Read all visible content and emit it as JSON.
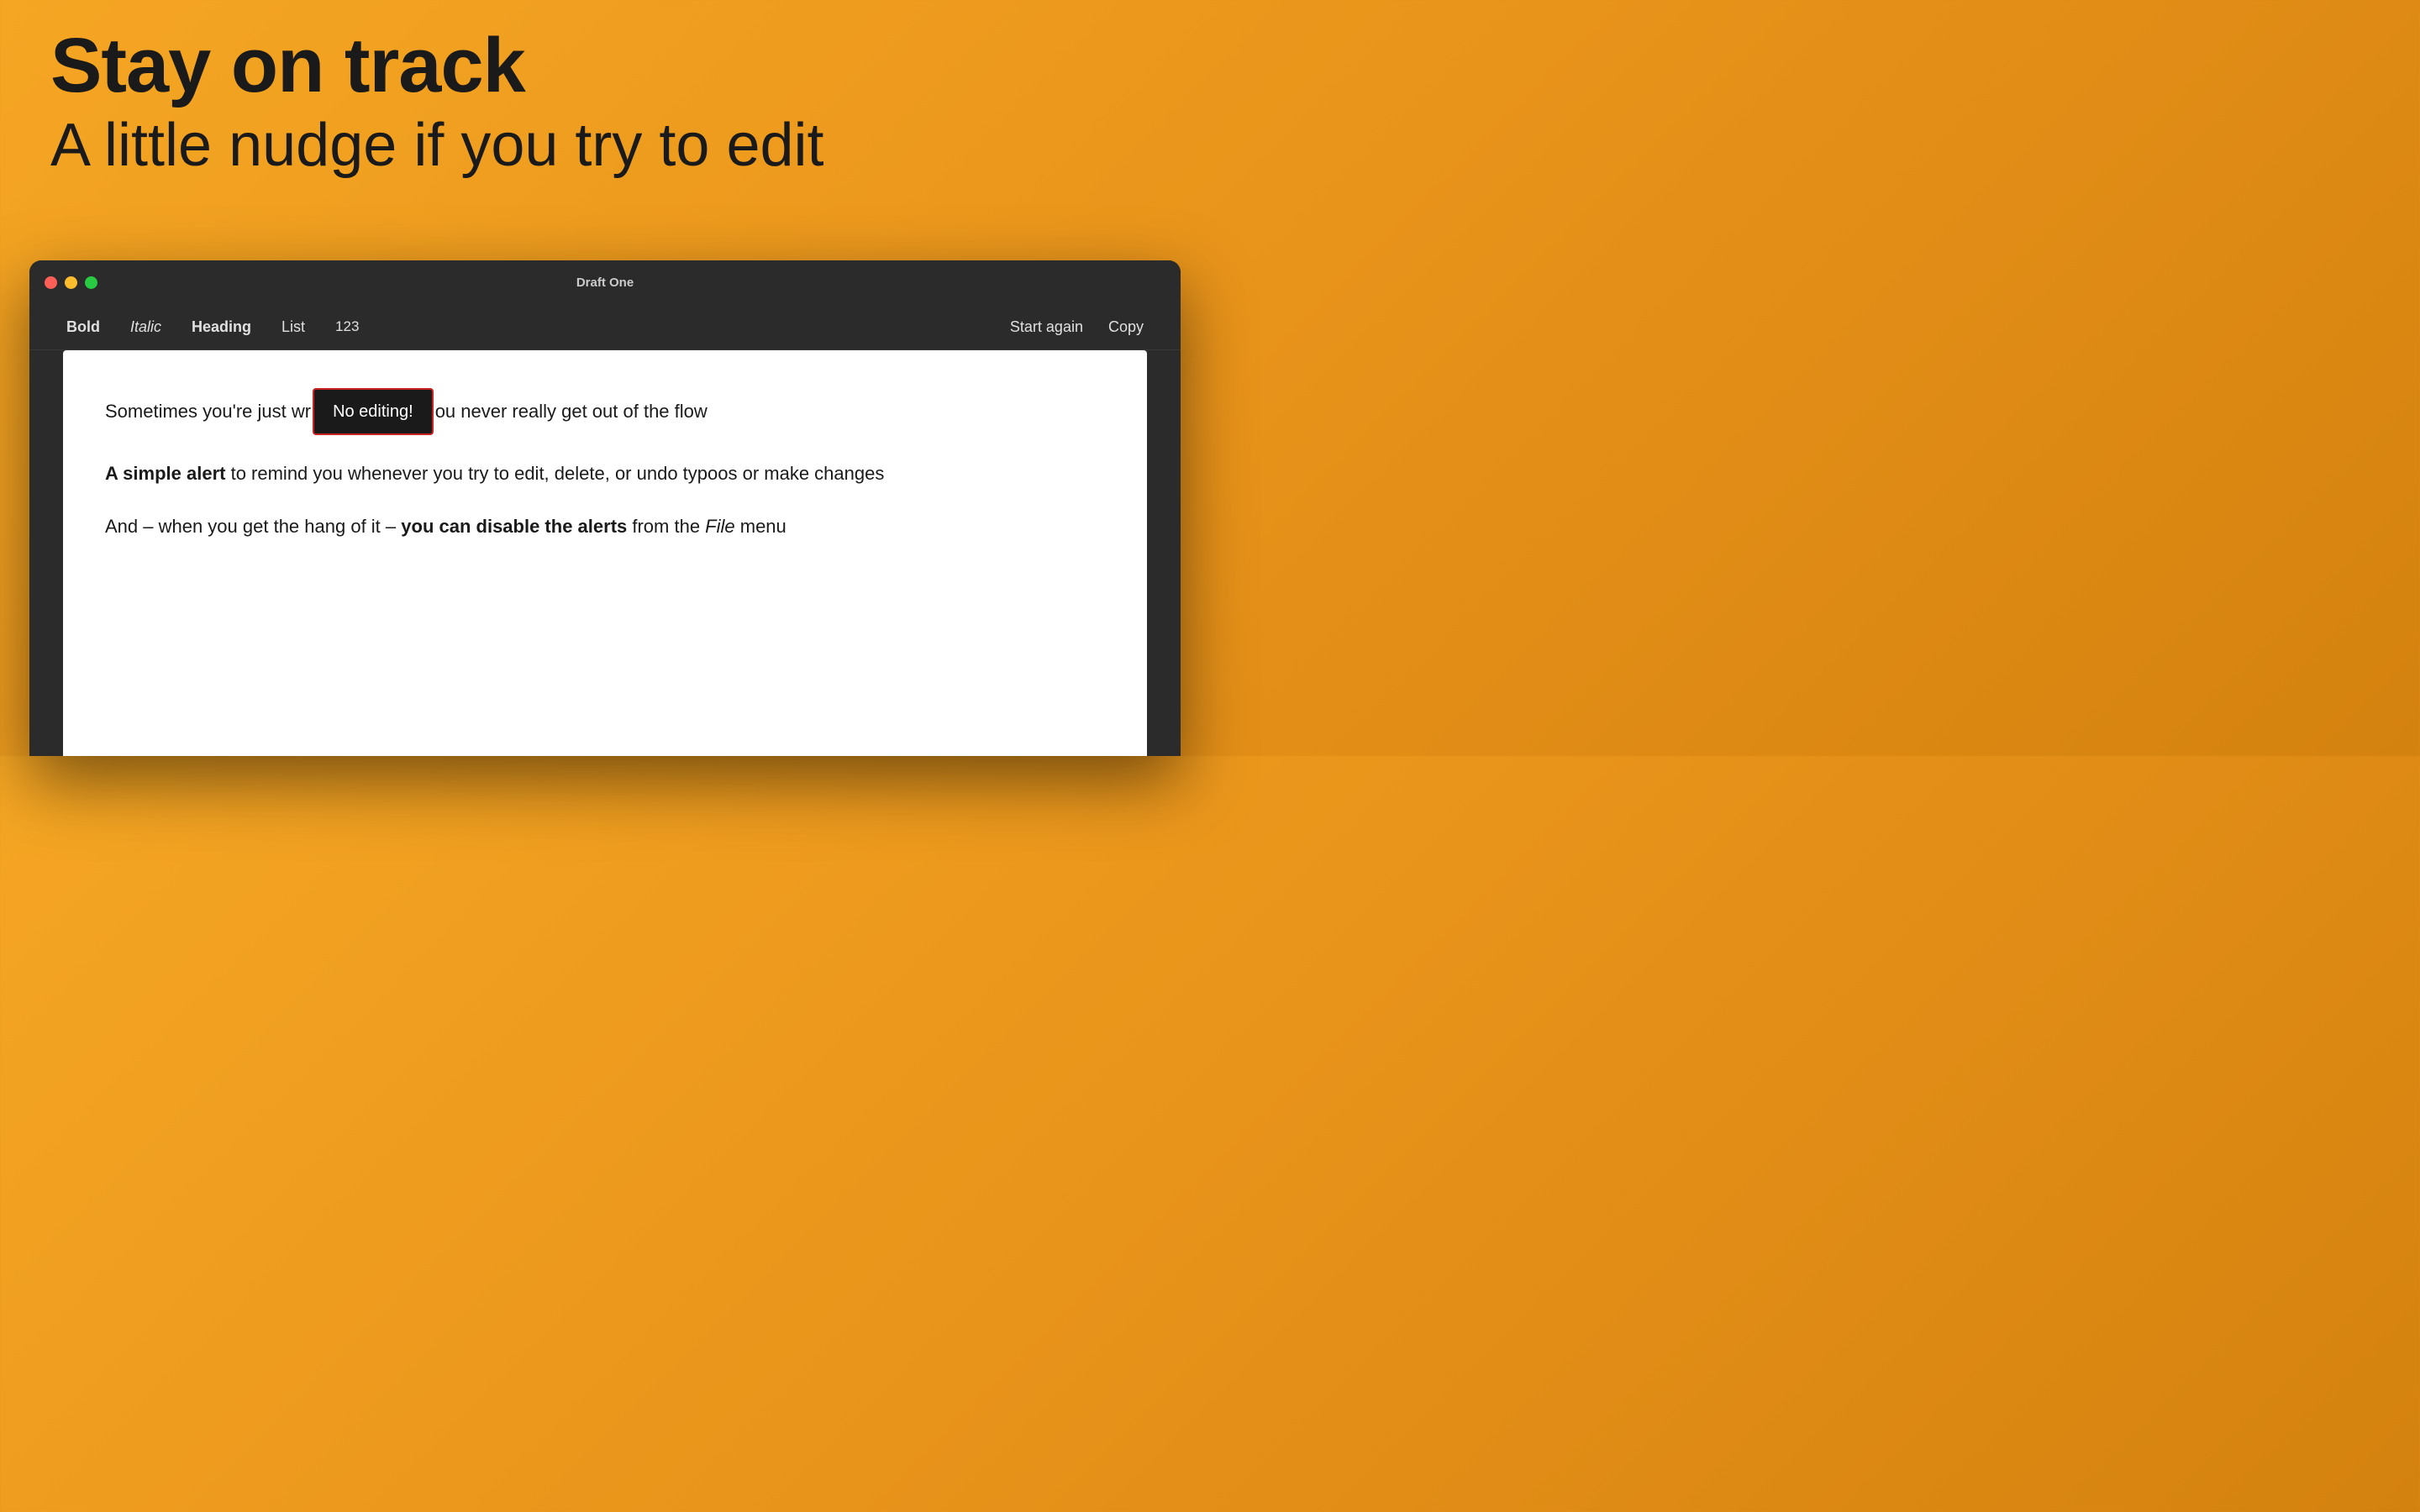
{
  "hero": {
    "title": "Stay on track",
    "subtitle": "A little nudge if you try to edit"
  },
  "window": {
    "title": "Draft One",
    "traffic_lights": {
      "close": "close",
      "minimize": "minimize",
      "maximize": "maximize"
    }
  },
  "toolbar": {
    "bold_label": "Bold",
    "italic_label": "Italic",
    "heading_label": "Heading",
    "list_label": "List",
    "number_label": "123",
    "start_again_label": "Start again",
    "copy_label": "Copy"
  },
  "editor": {
    "paragraph1_before": "Sometimes you're just wr",
    "tooltip_text": "No editing!",
    "paragraph1_after": "ou never really get out of the flow",
    "paragraph2_line1_bold": "A simple alert",
    "paragraph2_line1_rest": " to remind you whenever you try to edit, delete, or undo typoos or make changes",
    "paragraph3_before": "And – when you get the hang of it – ",
    "paragraph3_bold": "you can disable the alerts",
    "paragraph3_after": " from the ",
    "paragraph3_italic": "File",
    "paragraph3_end": " menu"
  },
  "colors": {
    "background_start": "#F5A623",
    "background_end": "#D4820F",
    "window_bg": "#2b2b2b",
    "close_dot": "#FF5F57",
    "minimize_dot": "#FFBD2E",
    "maximize_dot": "#28CA41",
    "tooltip_bg": "#1a1a1a",
    "tooltip_border": "#cc2222",
    "tooltip_text": "#ffffff",
    "editor_bg": "#ffffff",
    "editor_text": "#1a1a1a"
  }
}
